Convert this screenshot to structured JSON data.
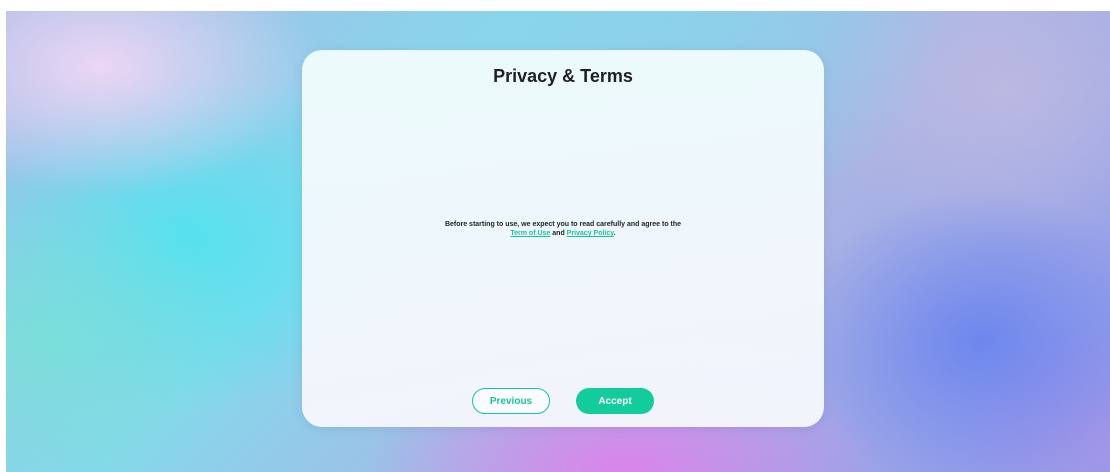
{
  "dialog": {
    "title": "Privacy & Terms",
    "message_line1": "Before starting to use, we expect you to read carefully and agree to the",
    "link_terms": "Term of Use",
    "conjunction": " and ",
    "link_privacy": "Privacy Policy",
    "period": "."
  },
  "buttons": {
    "previous_label": "Previous",
    "accept_label": "Accept"
  },
  "colors": {
    "accent": "#12cc9c",
    "link": "#19c3a0",
    "title_text": "#1f1f24"
  }
}
